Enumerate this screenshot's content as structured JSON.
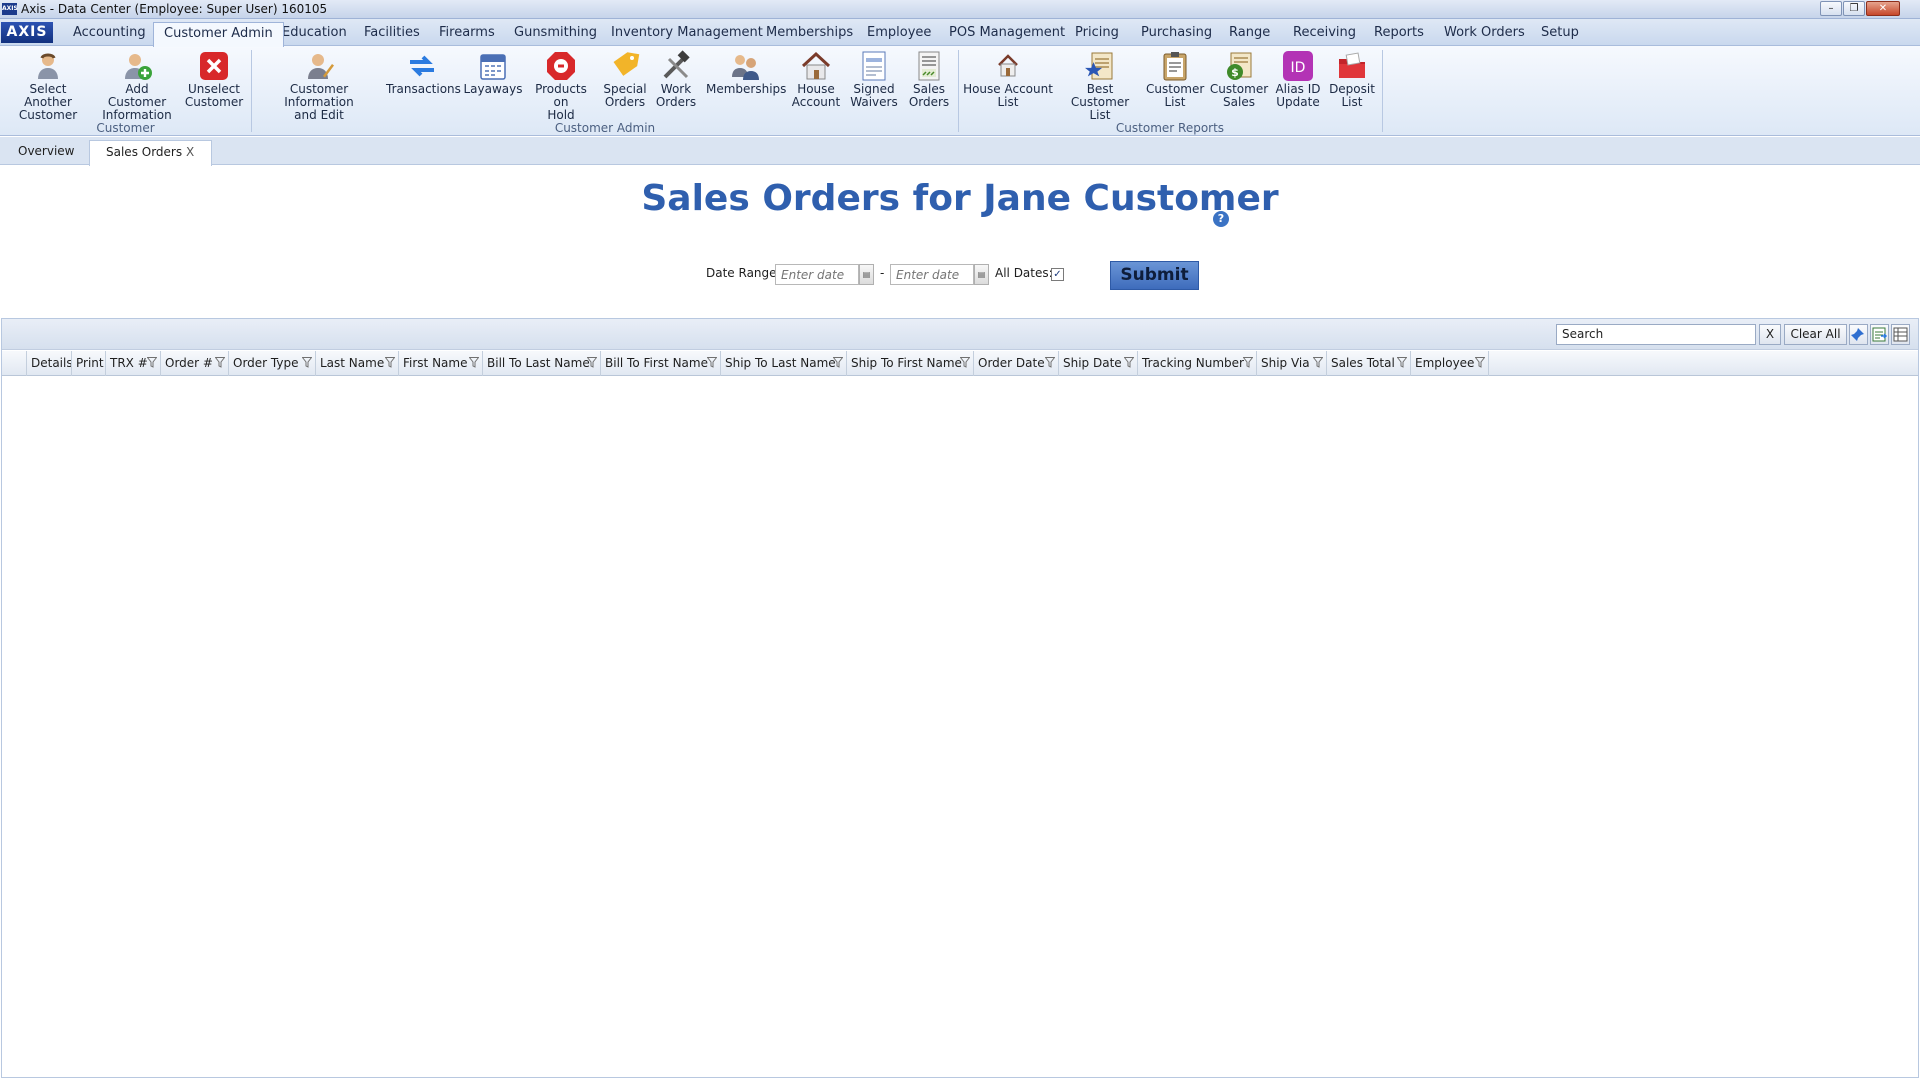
{
  "window": {
    "title": "Axis - Data Center  (Employee: Super User) 160105",
    "app_icon_text": "AXIS",
    "controls": {
      "minimize": "–",
      "restore": "❐",
      "close": "✕"
    }
  },
  "menubar": {
    "brand": "AXIS",
    "items": [
      "Accounting",
      "Customer Admin",
      "Education",
      "Facilities",
      "Firearms",
      "Gunsmithing",
      "Inventory Management",
      "Memberships",
      "Employee",
      "POS Management",
      "Pricing",
      "Purchasing",
      "Range",
      "Receiving",
      "Reports",
      "Work Orders",
      "Setup"
    ],
    "active": "Customer Admin"
  },
  "ribbon": {
    "groups": [
      {
        "label": "Customer",
        "buttons": [
          "Select Another\nCustomer",
          "Add Customer\nInformation",
          "Unselect\nCustomer"
        ]
      },
      {
        "label": "Customer Admin",
        "buttons": [
          "Customer Information\nand Edit",
          "Transactions",
          "Layaways",
          "Products on\nHold",
          "Special\nOrders",
          "Work\nOrders",
          "Memberships",
          "House\nAccount",
          "Signed\nWaivers",
          "Sales\nOrders"
        ]
      },
      {
        "label": "Customer Reports",
        "buttons": [
          "House Account\nList",
          "Best Customer\nList",
          "Customer\nList",
          "Customer\nSales",
          "Alias ID\nUpdate",
          "Deposit\nList"
        ]
      }
    ],
    "icons": [
      "person-icon",
      "add-person-icon",
      "remove-icon",
      "person-edit-icon",
      "transactions-arrows-icon",
      "calendar-icon",
      "stop-hold-icon",
      "special-tag-icon",
      "tools-icon",
      "people-icon",
      "house-icon",
      "waiver-document-icon",
      "sales-order-icon",
      "house-list-icon",
      "star-list-icon",
      "clipboard-list-icon",
      "money-bag-icon",
      "id-badge-icon",
      "red-folder-icon"
    ]
  },
  "tabs": {
    "items": [
      "Overview",
      "Sales Orders"
    ],
    "active": "Sales Orders",
    "close_glyph": "X"
  },
  "page": {
    "title": "Sales Orders for Jane Customer",
    "help_glyph": "?"
  },
  "filters": {
    "date_range_label": "Date Range:",
    "start_placeholder": "Enter date",
    "end_placeholder": "Enter date",
    "separator": "-",
    "all_dates_label": "All Dates:",
    "all_dates_checked": true,
    "check_glyph": "✓",
    "submit_label": "Submit"
  },
  "grid": {
    "search_value": "Search",
    "clear_x": "X",
    "clear_all": "Clear All",
    "toolbar_icons": [
      "pin-icon",
      "export-icon",
      "columns-icon"
    ],
    "columns": [
      "Details",
      "Print",
      "TRX #",
      "Order #",
      "Order Type",
      "Last Name",
      "First Name",
      "Bill To Last Name",
      "Bill To First Name",
      "Ship To Last Name",
      "Ship To First Name",
      "Order Date",
      "Ship Date",
      "Tracking Number",
      "Ship Via",
      "Sales Total",
      "Employee"
    ],
    "filterable": [
      false,
      false,
      true,
      true,
      true,
      true,
      true,
      true,
      true,
      true,
      true,
      true,
      true,
      true,
      true,
      true,
      true
    ],
    "rows": []
  },
  "colors": {
    "accent": "#2f5fae",
    "ribbon_bg": "#e8eff9",
    "submit": "#4f7cc8"
  }
}
